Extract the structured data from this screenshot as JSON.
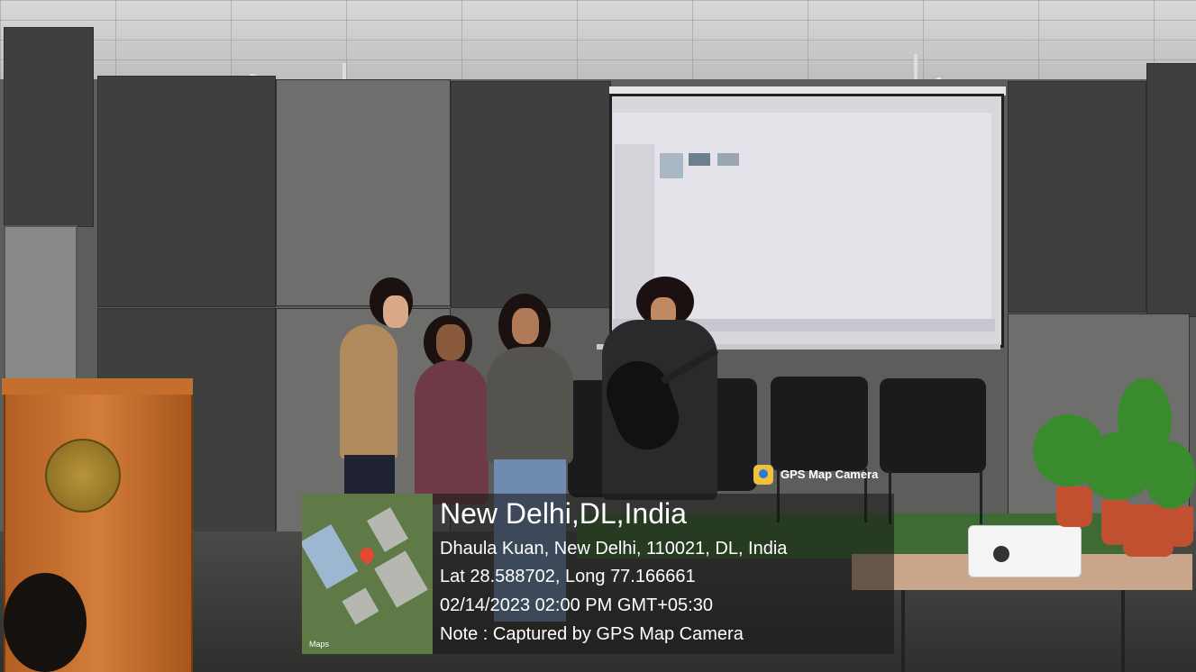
{
  "gps_overlay": {
    "app_name": "GPS Map Camera",
    "location_title": "New Delhi,DL,India",
    "address": "Dhaula Kuan, New Delhi, 110021, DL, India",
    "coordinates": "Lat 28.588702, Long 77.166661",
    "datetime": "02/14/2023 02:00 PM GMT+05:30",
    "note": "Note : Captured by GPS Map Camera",
    "map_attribution": "Maps"
  },
  "colors": {
    "carpet": "#3e6b34",
    "podium": "#c56e2e",
    "overlay": "rgba(20,20,20,.55)"
  }
}
